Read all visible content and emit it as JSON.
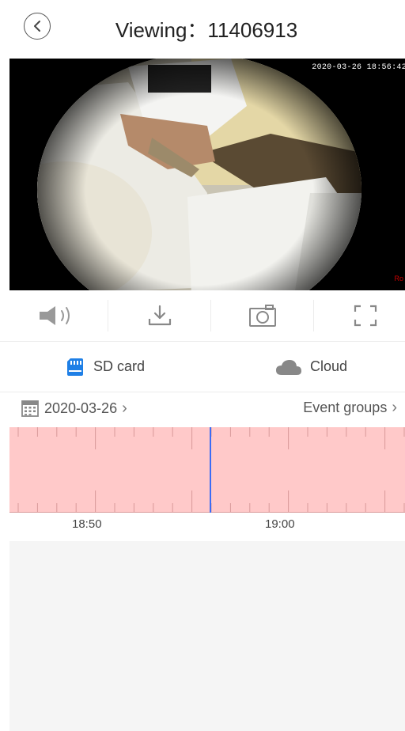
{
  "header": {
    "title": "Viewing：11406913"
  },
  "video": {
    "timestamp": "2020-03-26 18:56:42",
    "badge": "Ro"
  },
  "controls": {
    "items": [
      "speaker-icon",
      "download-icon",
      "camera-icon",
      "fullscreen-icon"
    ]
  },
  "storage": {
    "sd_label": "SD card",
    "cloud_label": "Cloud",
    "accent": "#1e7fe6"
  },
  "date_row": {
    "date": "2020-03-26",
    "events_label": "Event groups"
  },
  "timeline": {
    "labels": [
      "18:50",
      "19:00"
    ],
    "background": "#ffc9c9",
    "cursor_color": "#3b6cf5"
  }
}
